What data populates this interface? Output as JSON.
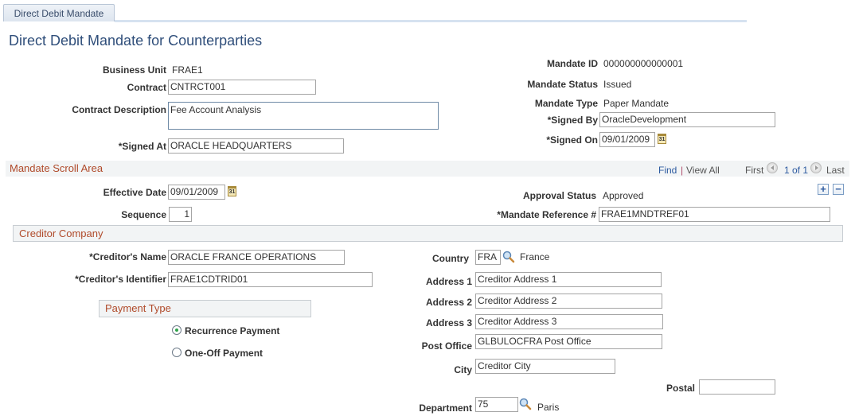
{
  "tab": {
    "label": "Direct Debit Mandate"
  },
  "page_title": "Direct Debit Mandate for Counterparties",
  "header": {
    "business_unit": {
      "label": "Business Unit",
      "value": "FRAE1"
    },
    "contract": {
      "label": "Contract",
      "value": "CNTRCT001"
    },
    "contract_description": {
      "label": "Contract Description",
      "value": "Fee Account Analysis"
    },
    "signed_at": {
      "label": "*Signed At",
      "value": "ORACLE HEADQUARTERS"
    },
    "mandate_id": {
      "label": "Mandate ID",
      "value": "000000000000001"
    },
    "mandate_status": {
      "label": "Mandate Status",
      "value": "Issued"
    },
    "mandate_type": {
      "label": "Mandate Type",
      "value": "Paper Mandate"
    },
    "signed_by": {
      "label": "*Signed By",
      "value": "OracleDevelopment"
    },
    "signed_on": {
      "label": "*Signed On",
      "value": "09/01/2009"
    }
  },
  "scroll_area": {
    "title": "Mandate Scroll Area",
    "find_label": "Find",
    "separator": "|",
    "view_all_label": "View All",
    "first_label": "First",
    "page_indicator": "1 of 1",
    "last_label": "Last",
    "add_label": "+",
    "remove_label": "−",
    "effective_date": {
      "label": "Effective Date",
      "value": "09/01/2009"
    },
    "sequence": {
      "label": "Sequence",
      "value": "1"
    },
    "approval_status": {
      "label": "Approval Status",
      "value": "Approved"
    },
    "mandate_reference": {
      "label": "*Mandate Reference #",
      "value": "FRAE1MNDTREF01"
    }
  },
  "creditor": {
    "title": "Creditor Company",
    "name": {
      "label": "*Creditor's Name",
      "value": "ORACLE FRANCE OPERATIONS"
    },
    "identifier": {
      "label": "*Creditor's Identifier",
      "value": "FRAE1CDTRID01"
    },
    "payment_type": {
      "title": "Payment Type",
      "options": [
        {
          "label": "Recurrence Payment",
          "selected": true
        },
        {
          "label": "One-Off Payment",
          "selected": false
        }
      ]
    },
    "country": {
      "label": "Country",
      "value": "FRA",
      "description": "France"
    },
    "address1": {
      "label": "Address 1",
      "value": "Creditor Address 1"
    },
    "address2": {
      "label": "Address 2",
      "value": "Creditor Address 2"
    },
    "address3": {
      "label": "Address 3",
      "value": "Creditor Address 3"
    },
    "post_office": {
      "label": "Post Office",
      "value": "GLBULOCFRA Post Office"
    },
    "city": {
      "label": "City",
      "value": "Creditor City"
    },
    "postal": {
      "label": "Postal",
      "value": ""
    },
    "department": {
      "label": "Department",
      "value": "75",
      "description": "Paris"
    }
  },
  "icons": {
    "calendar": "calendar-icon",
    "lookup": "magnifier-lookup-icon"
  },
  "colors": {
    "title": "#2f4e7a",
    "section_title": "#b04a2a",
    "link": "#2c5aa0",
    "radio_selected": "#2fa34a"
  }
}
